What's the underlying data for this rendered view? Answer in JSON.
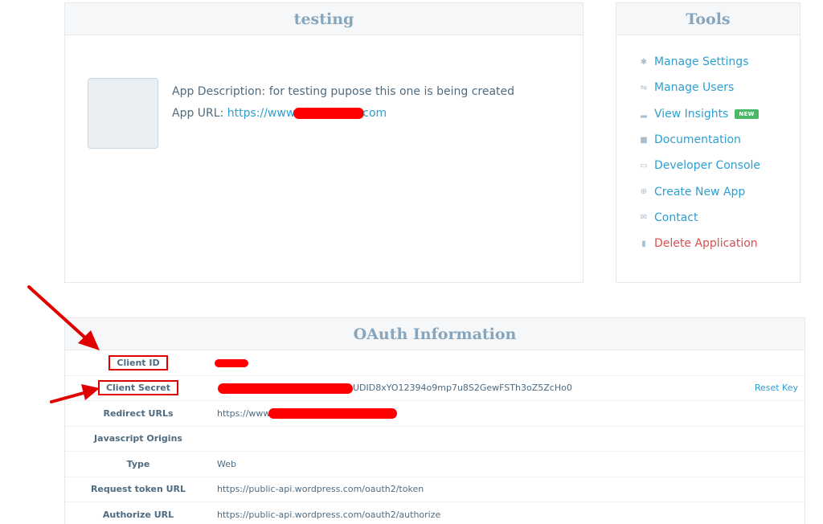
{
  "app_panel": {
    "title": "testing",
    "description_label": "App Description:",
    "description": "for testing pupose this one is being created",
    "url_label": "App URL:",
    "url_prefix": "https://www",
    "url_suffix": "com"
  },
  "tools": {
    "title": "Tools",
    "items": [
      {
        "label": "Manage Settings",
        "icon": "gear-icon"
      },
      {
        "label": "Manage Users",
        "icon": "users-icon"
      },
      {
        "label": "View Insights",
        "icon": "bar-chart-icon",
        "badge": "NEW"
      },
      {
        "label": "Documentation",
        "icon": "book-icon"
      },
      {
        "label": "Developer Console",
        "icon": "console-icon"
      },
      {
        "label": "Create New App",
        "icon": "plus-circle-icon"
      },
      {
        "label": "Contact",
        "icon": "mail-icon"
      },
      {
        "label": "Delete Application",
        "icon": "trash-icon"
      }
    ]
  },
  "oauth": {
    "title": "OAuth Information",
    "rows": [
      {
        "label": "Client ID",
        "value": ""
      },
      {
        "label": "Client Secret",
        "value": "UDID8xYO12394o9mp7u8S2GewFSTh3oZ5ZcHo0",
        "action": "Reset Key"
      },
      {
        "label": "Redirect URLs",
        "value": "https://www"
      },
      {
        "label": "Javascript Origins",
        "value": ""
      },
      {
        "label": "Type",
        "value": "Web"
      },
      {
        "label": "Request token URL",
        "value": "https://public-api.wordpress.com/oauth2/token"
      },
      {
        "label": "Authorize URL",
        "value": "https://public-api.wordpress.com/oauth2/authorize"
      }
    ]
  },
  "colors": {
    "link": "#2e9fd1",
    "danger": "#d94f4f",
    "badge": "#4ab866",
    "annotation": "#e00000"
  }
}
